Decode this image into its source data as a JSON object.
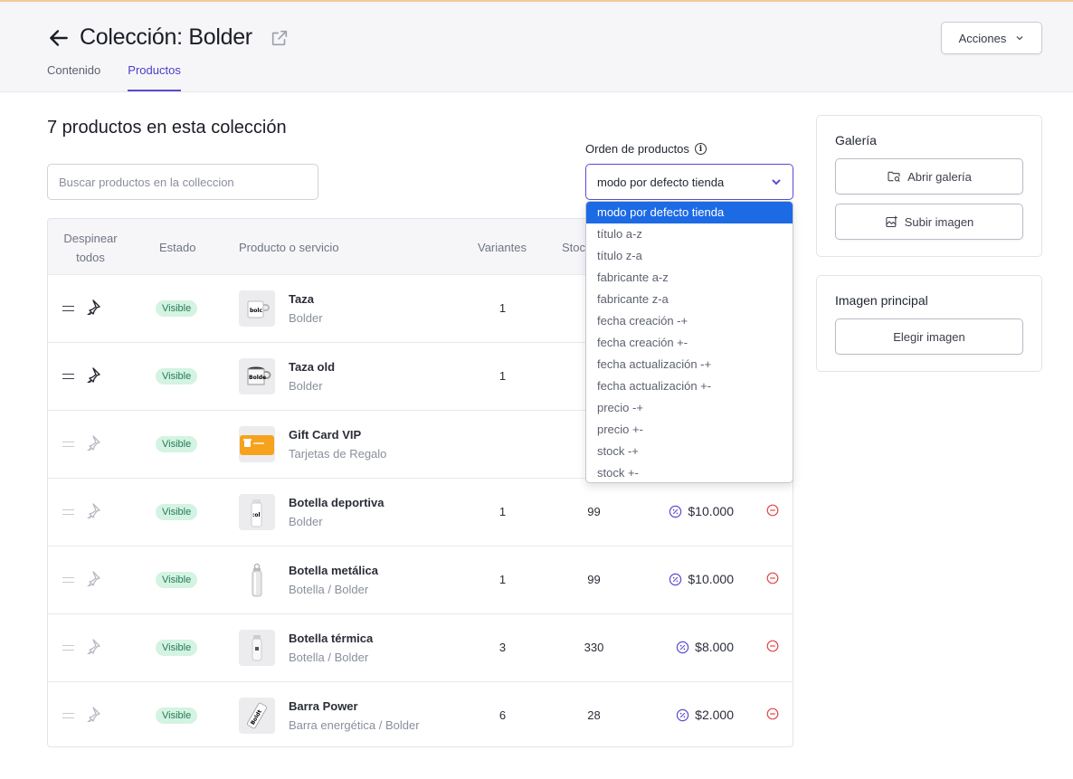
{
  "header": {
    "title": "Colección: Bolder",
    "tabs": [
      {
        "label": "Contenido",
        "active": false
      },
      {
        "label": "Productos",
        "active": true
      }
    ],
    "actions_label": "Acciones"
  },
  "main": {
    "count_text": "7 productos en esta colección",
    "search_placeholder": "Buscar productos en la colleccion",
    "order_label": "Orden de productos",
    "order_selected": "modo por defecto tienda",
    "order_options": [
      "modo por defecto tienda",
      "título a-z",
      "título z-a",
      "fabricante a-z",
      "fabricante z-a",
      "fecha creación -+",
      "fecha creación +-",
      "fecha actualización -+",
      "fecha actualización +-",
      "precio -+",
      "precio +-",
      "stock -+",
      "stock +-"
    ]
  },
  "table": {
    "headers": {
      "unpin_line1": "Despinear",
      "unpin_line2": "todos",
      "status": "Estado",
      "product": "Producto o servicio",
      "variants": "Variantes",
      "stock": "Stock"
    },
    "rows": [
      {
        "pinned": true,
        "status": "Visible",
        "name": "Taza",
        "sub": "Bolder",
        "variants": "1",
        "stock": "",
        "price": "",
        "thumb": "mug"
      },
      {
        "pinned": true,
        "status": "Visible",
        "name": "Taza old",
        "sub": "Bolder",
        "variants": "1",
        "stock": "",
        "price": "",
        "thumb": "mug-old"
      },
      {
        "pinned": false,
        "status": "Visible",
        "name": "Gift Card VIP",
        "sub": "Tarjetas de Regalo",
        "variants": "",
        "stock": "",
        "price": "",
        "thumb": "gift-card"
      },
      {
        "pinned": false,
        "status": "Visible",
        "name": "Botella deportiva",
        "sub": "Bolder",
        "variants": "1",
        "stock": "99",
        "price": "$10.000",
        "thumb": "bottle"
      },
      {
        "pinned": false,
        "status": "Visible",
        "name": "Botella metálica",
        "sub": "Botella / Bolder",
        "variants": "1",
        "stock": "99",
        "price": "$10.000",
        "thumb": "metal-bottle"
      },
      {
        "pinned": false,
        "status": "Visible",
        "name": "Botella térmica",
        "sub": "Botella / Bolder",
        "variants": "3",
        "stock": "330",
        "price": "$8.000",
        "thumb": "thermal-bottle"
      },
      {
        "pinned": false,
        "status": "Visible",
        "name": "Barra Power",
        "sub": "Barra energética / Bolder",
        "variants": "6",
        "stock": "28",
        "price": "$2.000",
        "thumb": "bar"
      }
    ]
  },
  "gallery": {
    "title": "Galería",
    "open_label": "Abrir galería",
    "upload_label": "Subir imagen"
  },
  "main_image": {
    "title": "Imagen principal",
    "choose_label": "Elegir imagen"
  },
  "colors": {
    "accent": "#5a4dd0",
    "selected_option": "#1d6ae5",
    "badge_bg": "#d4f3e3",
    "badge_text": "#237a55",
    "remove": "#e0474c"
  }
}
